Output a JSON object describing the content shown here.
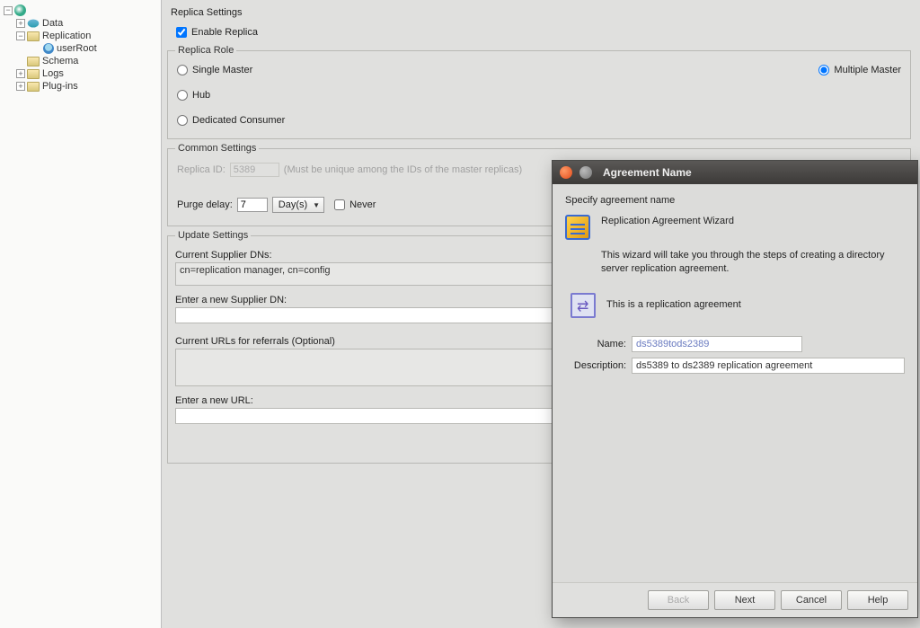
{
  "sidebar": {
    "items": [
      {
        "label": "Data",
        "icon": "db",
        "expander": "plus",
        "indent": 0
      },
      {
        "label": "Replication",
        "icon": "folder",
        "expander": "minus",
        "indent": 0
      },
      {
        "label": "userRoot",
        "icon": "user",
        "expander": "empty",
        "indent": 2
      },
      {
        "label": "Schema",
        "icon": "folder",
        "expander": "empty",
        "indent": 1
      },
      {
        "label": "Logs",
        "icon": "folder",
        "expander": "plus",
        "indent": 0
      },
      {
        "label": "Plug-ins",
        "icon": "folder",
        "expander": "plus",
        "indent": 0
      }
    ]
  },
  "settings": {
    "title": "Replica Settings",
    "enable_replica_label": "Enable Replica",
    "role_legend": "Replica Role",
    "single_master": "Single Master",
    "hub": "Hub",
    "dedicated_consumer": "Dedicated Consumer",
    "multiple_master": "Multiple Master",
    "common_legend": "Common Settings",
    "replica_id_label": "Replica ID:",
    "replica_id_value": "5389",
    "replica_id_hint": "(Must be unique among the IDs of the master replicas)",
    "purge_delay_label": "Purge delay:",
    "purge_delay_value": "7",
    "purge_unit": "Day(s)",
    "never_label": "Never",
    "update_legend": "Update Settings",
    "current_supplier_label": "Current Supplier DNs:",
    "current_supplier_value": "cn=replication manager, cn=config",
    "new_supplier_label": "Enter a new Supplier DN:",
    "referrals_label": "Current URLs for referrals (Optional)",
    "new_url_label": "Enter a new URL:"
  },
  "dialog": {
    "title": "Agreement Name",
    "subtitle": "Specify agreement name",
    "wizard_name": "Replication Agreement Wizard",
    "wizard_desc": "This wizard will take you through the steps of creating a directory server replication agreement.",
    "rep_text": "This is a replication agreement",
    "name_label": "Name:",
    "name_value": "ds5389tods2389",
    "desc_label": "Description:",
    "desc_value": "ds5389 to ds2389 replication agreement",
    "back": "Back",
    "next": "Next",
    "cancel": "Cancel",
    "help": "Help"
  }
}
